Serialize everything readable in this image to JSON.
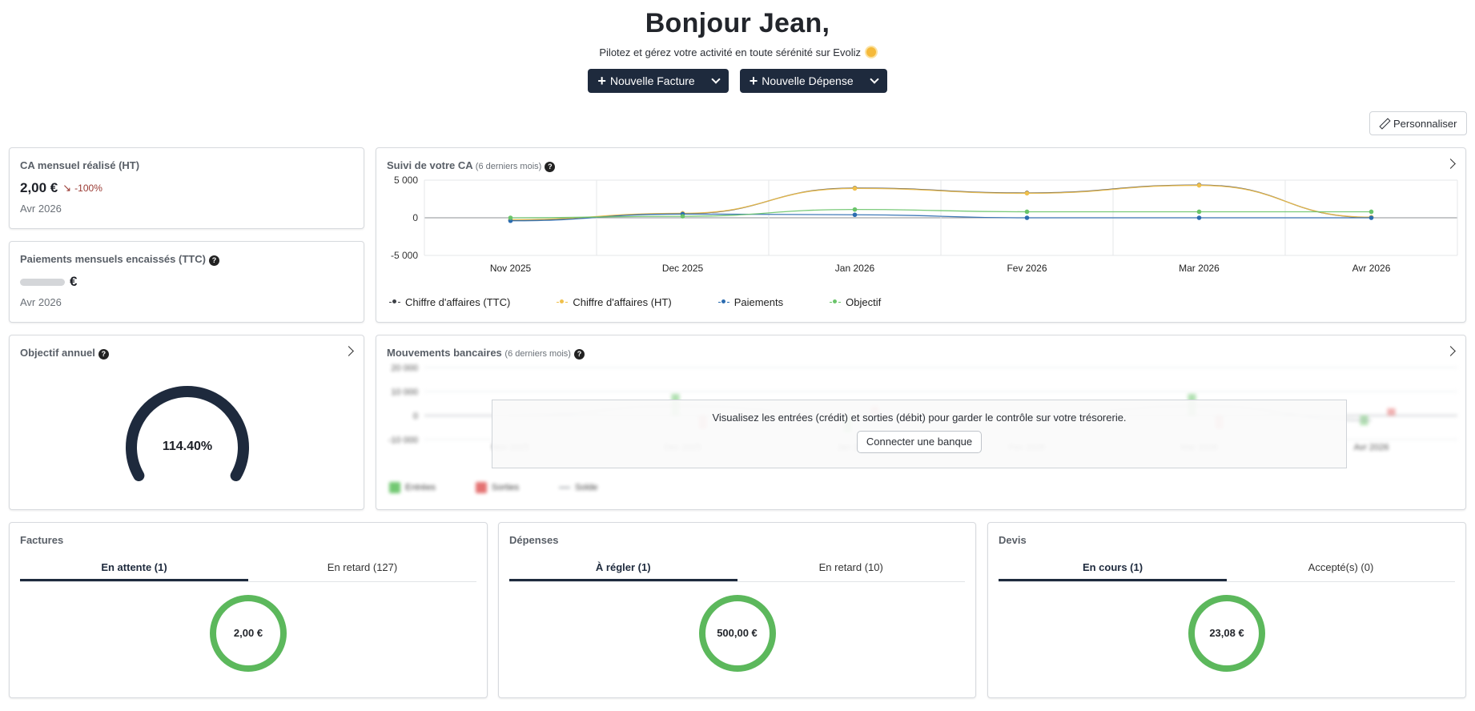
{
  "header": {
    "greeting": "Bonjour Jean,",
    "subtitle": "Pilotez et gérez votre activité en toute sérénité sur Evoliz",
    "new_invoice_label": "Nouvelle Facture",
    "new_expense_label": "Nouvelle Dépense",
    "customize_label": "Personnaliser"
  },
  "kpi_ca": {
    "title": "CA mensuel réalisé (HT)",
    "value": "2,00 €",
    "trend": "-100%",
    "date": "Avr 2026"
  },
  "kpi_payments": {
    "title": "Paiements mensuels encaissés (TTC)",
    "currency": "€",
    "date": "Avr 2026"
  },
  "annual_goal": {
    "title": "Objectif annuel",
    "percent_label": "114.40%",
    "progress": 1.144
  },
  "ca_chart": {
    "title": "Suivi de votre CA",
    "subtitle": "(6 derniers mois)",
    "legend": [
      "Chiffre d'affaires (TTC)",
      "Chiffre d'affaires (HT)",
      "Paiements",
      "Objectif"
    ]
  },
  "chart_data": [
    {
      "type": "line",
      "title": "Suivi de votre CA",
      "categories": [
        "Nov 2025",
        "Dec 2025",
        "Jan 2026",
        "Fev 2026",
        "Mar 2026",
        "Avr 2026"
      ],
      "yticks": [
        "5 000",
        "0",
        "-5 000"
      ],
      "ylim": [
        -5000,
        5000
      ],
      "grid": true,
      "legend_position": "bottom-left",
      "series": [
        {
          "name": "Chiffre d'affaires (TTC)",
          "color": "#3d4046",
          "values": [
            -300,
            550,
            3950,
            3300,
            4350,
            50
          ]
        },
        {
          "name": "Chiffre d'affaires (HT)",
          "color": "#f0c04b",
          "values": [
            -250,
            600,
            3900,
            3250,
            4300,
            80
          ]
        },
        {
          "name": "Paiements",
          "color": "#2b6cb0",
          "values": [
            -400,
            500,
            400,
            0,
            0,
            0
          ]
        },
        {
          "name": "Objectif",
          "color": "#6ac46a",
          "values": [
            0,
            200,
            1100,
            800,
            800,
            800
          ]
        }
      ]
    },
    {
      "type": "bar",
      "title": "Mouvements bancaires",
      "categories": [
        "Nov 2025",
        "Dec 2025",
        "Jan 2026",
        "Fev 2026",
        "Mar 2026",
        "Avr 2026"
      ],
      "yticks": [
        "20 000",
        "10 000",
        "0",
        "-10 000"
      ],
      "ylim": [
        -10000,
        20000
      ],
      "legend_position": "bottom-left",
      "series": [
        {
          "name": "Entrées",
          "color": "#5bbf5b",
          "values": [
            0,
            9000,
            -7000,
            0,
            9000,
            -4000
          ]
        },
        {
          "name": "Sorties",
          "color": "#e05a5a",
          "values": [
            0,
            -5500,
            4000,
            1000,
            -5500,
            3000
          ]
        },
        {
          "name": "Solde",
          "color": "#9aa0a6",
          "values": [
            0,
            4000,
            0,
            0,
            4000,
            -2000
          ]
        }
      ]
    }
  ],
  "bank": {
    "title": "Mouvements bancaires",
    "subtitle": "(6 derniers mois)",
    "message": "Visualisez les entrées (crédit) et sorties (débit) pour garder le contrôle sur votre trésorerie.",
    "connect_label": "Connecter une banque",
    "legend": [
      "Entrées",
      "Sorties",
      "Solde"
    ]
  },
  "factures": {
    "title": "Factures",
    "tab1": "En attente (1)",
    "tab2": "En retard (127)",
    "amount": "2,00 €"
  },
  "depenses": {
    "title": "Dépenses",
    "tab1": "À régler (1)",
    "tab2": "En retard (10)",
    "amount": "500,00 €"
  },
  "devis": {
    "title": "Devis",
    "tab1": "En cours (1)",
    "tab2": "Accepté(s) (0)",
    "amount": "23,08 €"
  },
  "colors": {
    "primary": "#1e2a3d",
    "accent_green": "#5cb85c",
    "trend_down": "#9a3a33"
  }
}
